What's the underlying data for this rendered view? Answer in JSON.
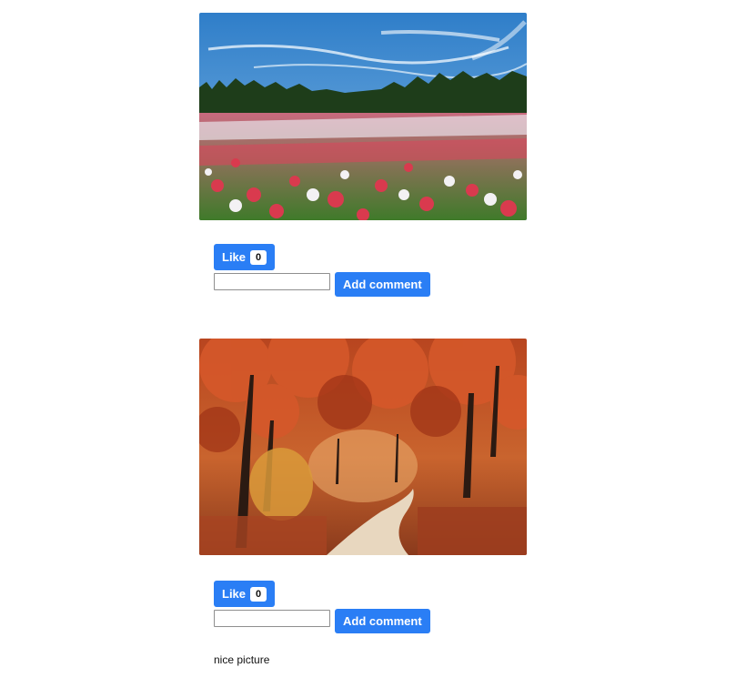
{
  "posts": [
    {
      "image_alt": "poppy-field-photo",
      "like_label": "Like",
      "like_count": "0",
      "comment_value": "",
      "add_comment_label": "Add comment",
      "comments": []
    },
    {
      "image_alt": "autumn-forest-photo",
      "like_label": "Like",
      "like_count": "0",
      "comment_value": "",
      "add_comment_label": "Add comment",
      "comments": [
        "nice picture"
      ]
    }
  ]
}
